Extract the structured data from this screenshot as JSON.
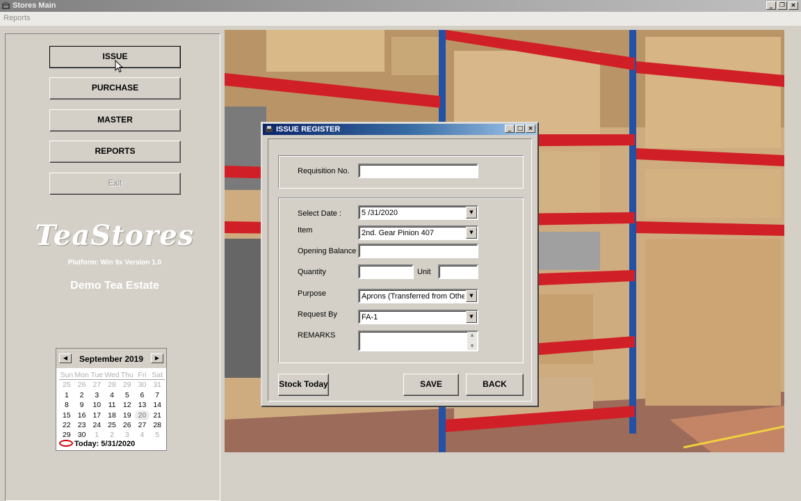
{
  "window": {
    "title": "Stores Main",
    "min_icon": "minimize-icon",
    "restore_icon": "restore-icon",
    "close_icon": "close-icon"
  },
  "menu": {
    "reports": "Reports"
  },
  "nav": {
    "issue": "ISSUE",
    "purchase": "PURCHASE",
    "master": "MASTER",
    "reports": "REPORTS",
    "exit": "Exit"
  },
  "brand": {
    "name": "TeaStores",
    "platform": "Platform: Win 9x  Version 1.0",
    "estate": "Demo Tea Estate"
  },
  "calendar": {
    "month_label": "September 2019",
    "weekdays": [
      "Sun",
      "Mon",
      "Tue",
      "Wed",
      "Thu",
      "Fri",
      "Sat"
    ],
    "weeks": [
      [
        "25",
        "26",
        "27",
        "28",
        "29",
        "30",
        "31"
      ],
      [
        "1",
        "2",
        "3",
        "4",
        "5",
        "6",
        "7"
      ],
      [
        "8",
        "9",
        "10",
        "11",
        "12",
        "13",
        "14"
      ],
      [
        "15",
        "16",
        "17",
        "18",
        "19",
        "20",
        "21"
      ],
      [
        "22",
        "23",
        "24",
        "25",
        "26",
        "27",
        "28"
      ],
      [
        "29",
        "30",
        "1",
        "2",
        "3",
        "4",
        "5"
      ]
    ],
    "selected_day": "20",
    "today_label": "Today: 5/31/2020"
  },
  "dialog": {
    "title": "ISSUE REGISTER",
    "requisition_label": "Requisition No.",
    "requisition_value": "",
    "date_label": "Select Date :",
    "date_value": "5 /31/2020",
    "item_label": "Item",
    "item_value": "2nd. Gear Pinion 407",
    "opening_label": "Opening Balance",
    "opening_value": "",
    "quantity_label": "Quantity",
    "quantity_value": "",
    "unit_label": "Unit",
    "unit_value": "",
    "purpose_label": "Purpose",
    "purpose_value": "Aprons (Transferred from Other welfa",
    "request_label": "Request By",
    "request_value": "FA-1",
    "remarks_label": "REMARKS",
    "remarks_value": "",
    "stock_today": "Stock Today",
    "save": "SAVE",
    "back": "BACK"
  },
  "colors": {
    "face": "#d4d0c8",
    "dialog_title": "#0a246a",
    "main_title": "#808080",
    "today_ring": "#d40000",
    "shelf_red": "#d01f26",
    "shelf_blue": "#2351a5"
  }
}
